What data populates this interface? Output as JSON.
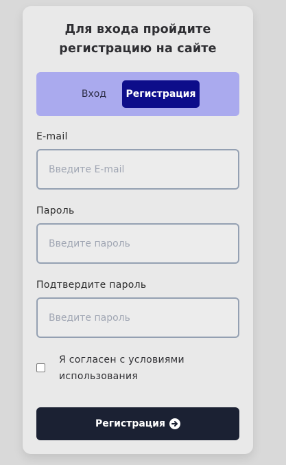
{
  "form": {
    "title_line1": "Для входа пройдите",
    "title_line2": "регистрацию на сайте",
    "tabs": {
      "login": "Вход",
      "register": "Регистрация",
      "active": "register"
    },
    "fields": {
      "email": {
        "label": "E-mail",
        "placeholder": "Введите E-mail",
        "value": ""
      },
      "password": {
        "label": "Пароль",
        "placeholder": "Введите пароль",
        "value": ""
      },
      "confirm": {
        "label": "Подтвердите пароль",
        "placeholder": "Введите пароль",
        "value": ""
      }
    },
    "agree": {
      "line1": "Я согласен с условиями",
      "line2": "использования",
      "checked": false
    },
    "submit": {
      "label": "Регистрация",
      "icon": "arrow-right-circle-icon"
    }
  },
  "colors": {
    "page_bg": "#d9d9d9",
    "card_bg": "#e9e9e9",
    "tabs_bg": "#aaaaee",
    "tab_active_bg": "#0d0d8a",
    "button_bg": "#1b2133",
    "input_border": "#94a0b2"
  }
}
